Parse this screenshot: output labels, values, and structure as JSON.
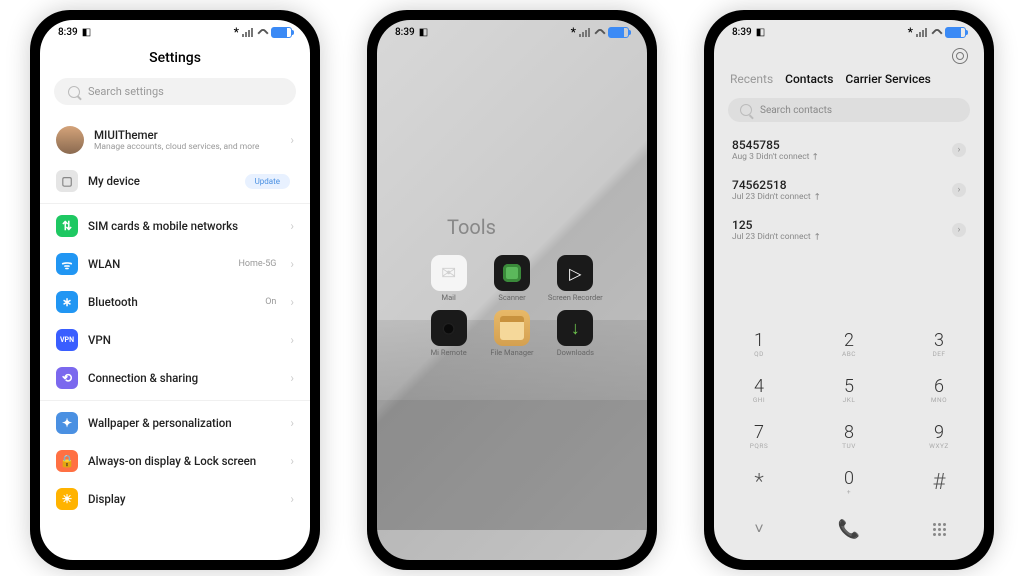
{
  "status": {
    "time": "8:39",
    "bt": "*"
  },
  "settings": {
    "title": "Settings",
    "search_ph": "Search settings",
    "account": {
      "name": "MIUIThemer",
      "sub": "Manage accounts, cloud services, and more"
    },
    "mydevice": {
      "label": "My device",
      "badge": "Update"
    },
    "items": [
      {
        "label": "SIM cards & mobile networks",
        "val": ""
      },
      {
        "label": "WLAN",
        "val": "Home-5G"
      },
      {
        "label": "Bluetooth",
        "val": "On"
      },
      {
        "label": "VPN",
        "val": ""
      },
      {
        "label": "Connection & sharing",
        "val": ""
      }
    ],
    "items2": [
      {
        "label": "Wallpaper & personalization"
      },
      {
        "label": "Always-on display & Lock screen"
      },
      {
        "label": "Display"
      }
    ]
  },
  "tools": {
    "title": "Tools",
    "apps": [
      {
        "label": "Mail"
      },
      {
        "label": "Scanner"
      },
      {
        "label": "Screen Recorder"
      },
      {
        "label": "Mi Remote"
      },
      {
        "label": "File Manager"
      },
      {
        "label": "Downloads"
      }
    ]
  },
  "dialer": {
    "tabs": [
      "Recents",
      "Contacts",
      "Carrier Services"
    ],
    "search_ph": "Search contacts",
    "calls": [
      {
        "num": "8545785",
        "meta": "Aug 3 Didn't connect"
      },
      {
        "num": "74562518",
        "meta": "Jul 23 Didn't connect"
      },
      {
        "num": "125",
        "meta": "Jul 23 Didn't connect"
      }
    ],
    "keys": [
      {
        "n": "1",
        "l": "QD"
      },
      {
        "n": "2",
        "l": "ABC"
      },
      {
        "n": "3",
        "l": "DEF"
      },
      {
        "n": "4",
        "l": "GHI"
      },
      {
        "n": "5",
        "l": "JKL"
      },
      {
        "n": "6",
        "l": "MNO"
      },
      {
        "n": "7",
        "l": "PQRS"
      },
      {
        "n": "8",
        "l": "TUV"
      },
      {
        "n": "9",
        "l": "WXYZ"
      },
      {
        "n": "*",
        "l": ""
      },
      {
        "n": "0",
        "l": "+"
      },
      {
        "n": "#",
        "l": ""
      }
    ]
  }
}
